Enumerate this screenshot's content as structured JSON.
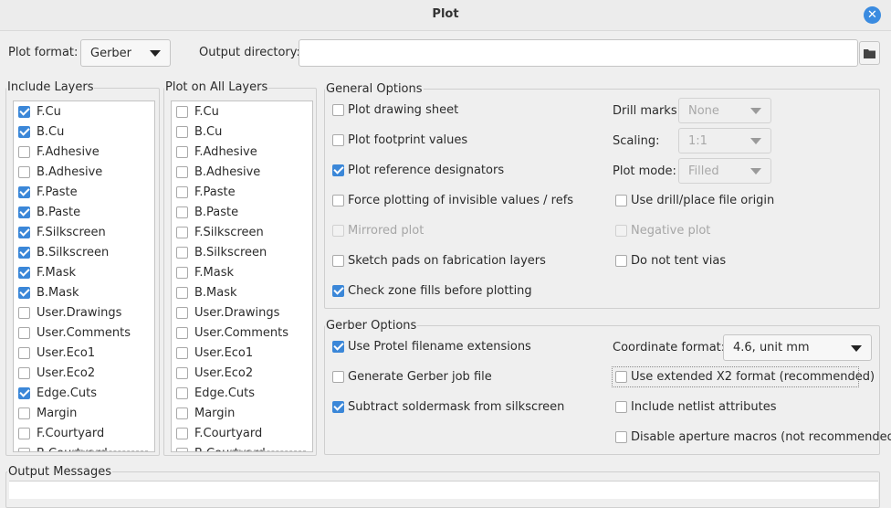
{
  "window": {
    "title": "Plot"
  },
  "format": {
    "label": "Plot format:",
    "value": "Gerber",
    "output_dir_label": "Output directory:",
    "output_dir_value": ""
  },
  "include_layers": {
    "title": "Include Layers",
    "items": [
      {
        "label": "F.Cu",
        "checked": true
      },
      {
        "label": "B.Cu",
        "checked": true
      },
      {
        "label": "F.Adhesive",
        "checked": false
      },
      {
        "label": "B.Adhesive",
        "checked": false
      },
      {
        "label": "F.Paste",
        "checked": true
      },
      {
        "label": "B.Paste",
        "checked": true
      },
      {
        "label": "F.Silkscreen",
        "checked": true
      },
      {
        "label": "B.Silkscreen",
        "checked": true
      },
      {
        "label": "F.Mask",
        "checked": true
      },
      {
        "label": "B.Mask",
        "checked": true
      },
      {
        "label": "User.Drawings",
        "checked": false
      },
      {
        "label": "User.Comments",
        "checked": false
      },
      {
        "label": "User.Eco1",
        "checked": false
      },
      {
        "label": "User.Eco2",
        "checked": false
      },
      {
        "label": "Edge.Cuts",
        "checked": true
      },
      {
        "label": "Margin",
        "checked": false
      },
      {
        "label": "F.Courtyard",
        "checked": false
      },
      {
        "label": "B.Courtyard",
        "checked": false
      }
    ]
  },
  "plot_all_layers": {
    "title": "Plot on All Layers",
    "items": [
      {
        "label": "F.Cu",
        "checked": false
      },
      {
        "label": "B.Cu",
        "checked": false
      },
      {
        "label": "F.Adhesive",
        "checked": false
      },
      {
        "label": "B.Adhesive",
        "checked": false
      },
      {
        "label": "F.Paste",
        "checked": false
      },
      {
        "label": "B.Paste",
        "checked": false
      },
      {
        "label": "F.Silkscreen",
        "checked": false
      },
      {
        "label": "B.Silkscreen",
        "checked": false
      },
      {
        "label": "F.Mask",
        "checked": false
      },
      {
        "label": "B.Mask",
        "checked": false
      },
      {
        "label": "User.Drawings",
        "checked": false
      },
      {
        "label": "User.Comments",
        "checked": false
      },
      {
        "label": "User.Eco1",
        "checked": false
      },
      {
        "label": "User.Eco2",
        "checked": false
      },
      {
        "label": "Edge.Cuts",
        "checked": false
      },
      {
        "label": "Margin",
        "checked": false
      },
      {
        "label": "F.Courtyard",
        "checked": false
      },
      {
        "label": "B.Courtyard",
        "checked": false
      }
    ]
  },
  "general": {
    "title": "General Options",
    "plot_drawing_sheet": {
      "label": "Plot drawing sheet",
      "checked": false
    },
    "plot_footprint_values": {
      "label": "Plot footprint values",
      "checked": false
    },
    "plot_reference_designators": {
      "label": "Plot reference designators",
      "checked": true
    },
    "force_invisible": {
      "label": "Force plotting of invisible values / refs",
      "checked": false
    },
    "mirrored_plot": {
      "label": "Mirrored plot",
      "checked": false,
      "disabled": true
    },
    "sketch_pads": {
      "label": "Sketch pads on fabrication layers",
      "checked": false
    },
    "check_zone_fills": {
      "label": "Check zone fills before plotting",
      "checked": true
    },
    "drill_marks_label": "Drill marks:",
    "drill_marks_value": "None",
    "scaling_label": "Scaling:",
    "scaling_value": "1:1",
    "plot_mode_label": "Plot mode:",
    "plot_mode_value": "Filled",
    "use_drill_origin": {
      "label": "Use drill/place file origin",
      "checked": false
    },
    "negative_plot": {
      "label": "Negative plot",
      "checked": false,
      "disabled": true
    },
    "do_not_tent_vias": {
      "label": "Do not tent vias",
      "checked": false
    }
  },
  "gerber": {
    "title": "Gerber Options",
    "use_protel": {
      "label": "Use Protel filename extensions",
      "checked": true
    },
    "generate_job_file": {
      "label": "Generate Gerber job file",
      "checked": false
    },
    "subtract_soldermask": {
      "label": "Subtract soldermask from silkscreen",
      "checked": true
    },
    "coord_format_label": "Coordinate format:",
    "coord_format_value": "4.6, unit mm",
    "use_x2": {
      "label": "Use extended X2 format (recommended)",
      "checked": false
    },
    "include_netlist": {
      "label": "Include netlist attributes",
      "checked": false
    },
    "disable_aperture_macros": {
      "label": "Disable aperture macros (not recommended)",
      "checked": false
    }
  },
  "messages": {
    "title": "Output Messages"
  }
}
